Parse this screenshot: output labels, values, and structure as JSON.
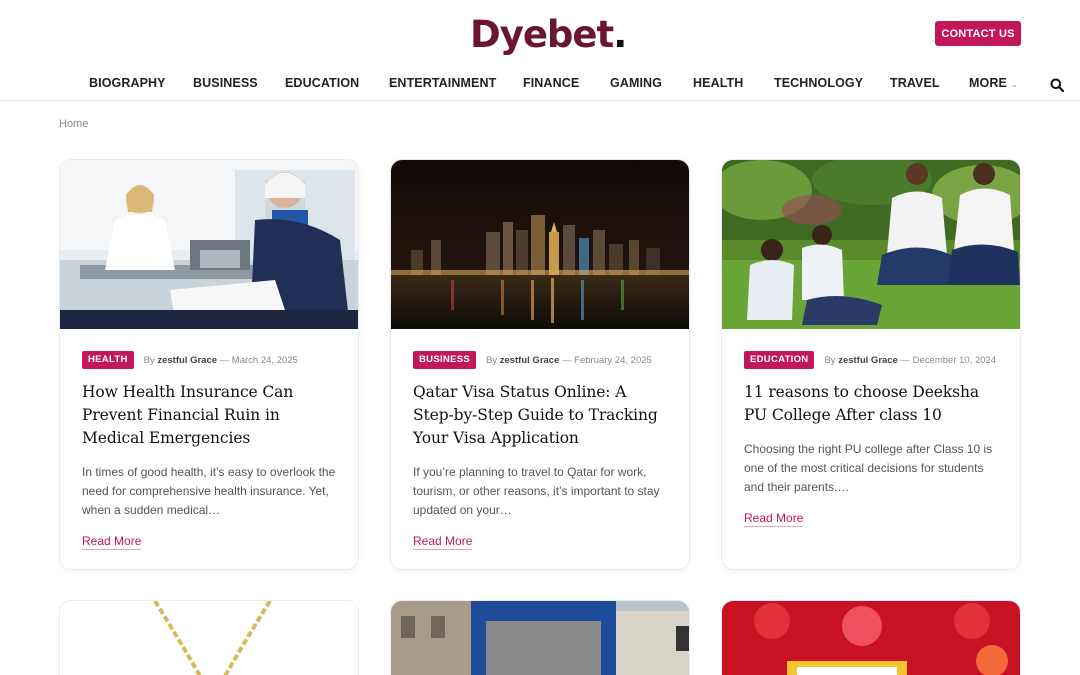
{
  "header": {
    "logo_text": "Dyebet",
    "logo_dot": ".",
    "contact_label": "CONTACT US"
  },
  "nav": {
    "items": [
      "BIOGRAPHY",
      "BUSINESS",
      "EDUCATION",
      "ENTERTAINMENT",
      "FINANCE",
      "GAMING",
      "HEALTH",
      "TECHNOLOGY",
      "TRAVEL"
    ],
    "more_label": "MORE"
  },
  "breadcrumb": "Home",
  "posts": [
    {
      "category": "HEALTH",
      "by": "By",
      "author": "zestful Grace",
      "date": "— March 24, 2025",
      "title": "How Health Insurance Can Prevent Financial Ruin in Medical Emergencies",
      "excerpt": "In times of good health, it’s easy to overlook the need for comprehensive health insurance. Yet, when a sudden medical…",
      "read_more": "Read More"
    },
    {
      "category": "BUSINESS",
      "by": "By",
      "author": "zestful Grace",
      "date": "— February 24, 2025",
      "title": "Qatar Visa Status Online: A Step-by-Step Guide to Tracking Your Visa Application",
      "excerpt": "If you’re planning to travel to Qatar for work, tourism, or other reasons, it’s important to stay updated on your…",
      "read_more": "Read More"
    },
    {
      "category": "EDUCATION",
      "by": "By",
      "author": "zestful Grace",
      "date": "— December 10, 2024",
      "title": "11 reasons to choose Deeksha PU College After class 10",
      "excerpt": "Choosing the right PU college after Class 10 is one of the most critical decisions for students and their parents.…",
      "read_more": "Read More"
    }
  ],
  "colors": {
    "accent": "#c2185b",
    "logo": "#6b1530"
  }
}
